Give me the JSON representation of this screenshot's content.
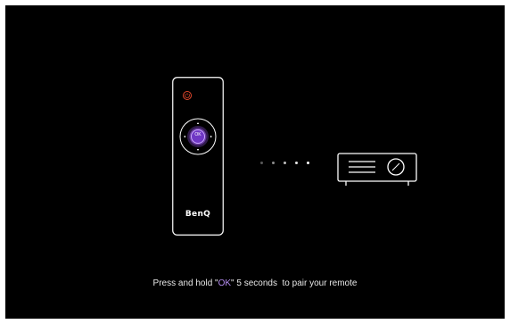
{
  "remote": {
    "brand_label": "BenQ",
    "ok_label": "OK",
    "icons": [
      "power-icon",
      "dpad-icon",
      "ok-button-icon"
    ]
  },
  "pairing": {
    "dot_count": 5,
    "projector_icon": "projector-icon"
  },
  "instruction": {
    "prefix": "Press and hold \"",
    "highlight": "OK",
    "suffix": "\" 5 seconds  to pair your remote"
  },
  "colors": {
    "background": "#000000",
    "accent": "#8a4dd8",
    "power": "#e0472c",
    "text": "#e8e8e8",
    "highlight_text": "#b48cf0"
  }
}
